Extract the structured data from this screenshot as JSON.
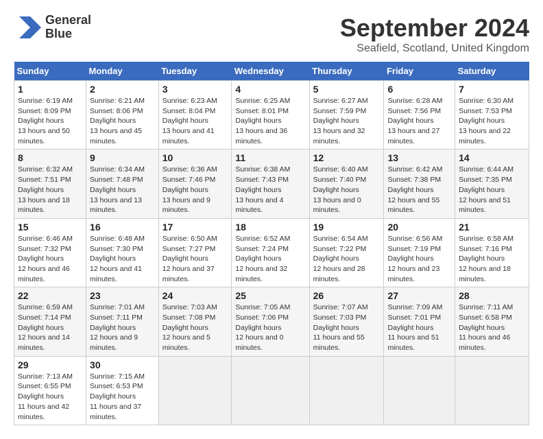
{
  "header": {
    "logo_line1": "General",
    "logo_line2": "Blue",
    "title": "September 2024",
    "subtitle": "Seafield, Scotland, United Kingdom"
  },
  "days_of_week": [
    "Sunday",
    "Monday",
    "Tuesday",
    "Wednesday",
    "Thursday",
    "Friday",
    "Saturday"
  ],
  "weeks": [
    [
      {
        "date": "1",
        "sunrise": "6:19 AM",
        "sunset": "8:09 PM",
        "daylight": "13 hours and 50 minutes."
      },
      {
        "date": "2",
        "sunrise": "6:21 AM",
        "sunset": "8:06 PM",
        "daylight": "13 hours and 45 minutes."
      },
      {
        "date": "3",
        "sunrise": "6:23 AM",
        "sunset": "8:04 PM",
        "daylight": "13 hours and 41 minutes."
      },
      {
        "date": "4",
        "sunrise": "6:25 AM",
        "sunset": "8:01 PM",
        "daylight": "13 hours and 36 minutes."
      },
      {
        "date": "5",
        "sunrise": "6:27 AM",
        "sunset": "7:59 PM",
        "daylight": "13 hours and 32 minutes."
      },
      {
        "date": "6",
        "sunrise": "6:28 AM",
        "sunset": "7:56 PM",
        "daylight": "13 hours and 27 minutes."
      },
      {
        "date": "7",
        "sunrise": "6:30 AM",
        "sunset": "7:53 PM",
        "daylight": "13 hours and 22 minutes."
      }
    ],
    [
      {
        "date": "8",
        "sunrise": "6:32 AM",
        "sunset": "7:51 PM",
        "daylight": "13 hours and 18 minutes."
      },
      {
        "date": "9",
        "sunrise": "6:34 AM",
        "sunset": "7:48 PM",
        "daylight": "13 hours and 13 minutes."
      },
      {
        "date": "10",
        "sunrise": "6:36 AM",
        "sunset": "7:46 PM",
        "daylight": "13 hours and 9 minutes."
      },
      {
        "date": "11",
        "sunrise": "6:38 AM",
        "sunset": "7:43 PM",
        "daylight": "13 hours and 4 minutes."
      },
      {
        "date": "12",
        "sunrise": "6:40 AM",
        "sunset": "7:40 PM",
        "daylight": "13 hours and 0 minutes."
      },
      {
        "date": "13",
        "sunrise": "6:42 AM",
        "sunset": "7:38 PM",
        "daylight": "12 hours and 55 minutes."
      },
      {
        "date": "14",
        "sunrise": "6:44 AM",
        "sunset": "7:35 PM",
        "daylight": "12 hours and 51 minutes."
      }
    ],
    [
      {
        "date": "15",
        "sunrise": "6:46 AM",
        "sunset": "7:32 PM",
        "daylight": "12 hours and 46 minutes."
      },
      {
        "date": "16",
        "sunrise": "6:48 AM",
        "sunset": "7:30 PM",
        "daylight": "12 hours and 41 minutes."
      },
      {
        "date": "17",
        "sunrise": "6:50 AM",
        "sunset": "7:27 PM",
        "daylight": "12 hours and 37 minutes."
      },
      {
        "date": "18",
        "sunrise": "6:52 AM",
        "sunset": "7:24 PM",
        "daylight": "12 hours and 32 minutes."
      },
      {
        "date": "19",
        "sunrise": "6:54 AM",
        "sunset": "7:22 PM",
        "daylight": "12 hours and 28 minutes."
      },
      {
        "date": "20",
        "sunrise": "6:56 AM",
        "sunset": "7:19 PM",
        "daylight": "12 hours and 23 minutes."
      },
      {
        "date": "21",
        "sunrise": "6:58 AM",
        "sunset": "7:16 PM",
        "daylight": "12 hours and 18 minutes."
      }
    ],
    [
      {
        "date": "22",
        "sunrise": "6:59 AM",
        "sunset": "7:14 PM",
        "daylight": "12 hours and 14 minutes."
      },
      {
        "date": "23",
        "sunrise": "7:01 AM",
        "sunset": "7:11 PM",
        "daylight": "12 hours and 9 minutes."
      },
      {
        "date": "24",
        "sunrise": "7:03 AM",
        "sunset": "7:08 PM",
        "daylight": "12 hours and 5 minutes."
      },
      {
        "date": "25",
        "sunrise": "7:05 AM",
        "sunset": "7:06 PM",
        "daylight": "12 hours and 0 minutes."
      },
      {
        "date": "26",
        "sunrise": "7:07 AM",
        "sunset": "7:03 PM",
        "daylight": "11 hours and 55 minutes."
      },
      {
        "date": "27",
        "sunrise": "7:09 AM",
        "sunset": "7:01 PM",
        "daylight": "11 hours and 51 minutes."
      },
      {
        "date": "28",
        "sunrise": "7:11 AM",
        "sunset": "6:58 PM",
        "daylight": "11 hours and 46 minutes."
      }
    ],
    [
      {
        "date": "29",
        "sunrise": "7:13 AM",
        "sunset": "6:55 PM",
        "daylight": "11 hours and 42 minutes."
      },
      {
        "date": "30",
        "sunrise": "7:15 AM",
        "sunset": "6:53 PM",
        "daylight": "11 hours and 37 minutes."
      },
      null,
      null,
      null,
      null,
      null
    ]
  ]
}
